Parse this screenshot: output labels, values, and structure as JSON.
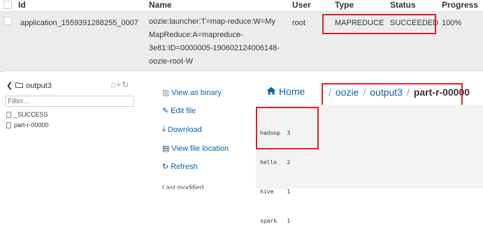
{
  "jobs_table": {
    "headers": [
      "Id",
      "Name",
      "User",
      "Type",
      "Status",
      "Progress"
    ],
    "row": {
      "id": "application_1559391288255_0007",
      "name_lines": [
        "oozie:launcher:T=map-reduce:W=My",
        "MapReduce:A=mapreduce-",
        "3e81:ID=0000005-190602124006148-",
        "oozie-root-W"
      ],
      "user": "root",
      "type": "MAPREDUCE",
      "status": "SUCCEEDED",
      "progress": "100%"
    }
  },
  "file_browser": {
    "folder_name": "output3",
    "back_icon": "chevron-left-icon",
    "folder_icon": "folder-icon",
    "actions_icons": [
      "home-icon",
      "plus-icon",
      "refresh-icon"
    ],
    "actions_glyphs": "⌂+↻",
    "filter_placeholder": "Filter...",
    "files": [
      "_SUCCESS",
      "part-r-00000"
    ]
  },
  "file_actions": {
    "view_as_binary": "View as binary",
    "edit_file": "Edit file",
    "download": "Download",
    "view_file_location": "View file location",
    "refresh": "Refresh",
    "last_modified_label": "Last modified"
  },
  "breadcrumb": {
    "home": "Home",
    "separator": "/",
    "parts": [
      "oozie",
      "output3",
      "part-r-00000"
    ]
  },
  "file_content": {
    "lines": [
      "hadoop  3",
      "hello   2",
      "hive    1",
      "spark   1"
    ]
  },
  "colors": {
    "highlight": "#e41f2d",
    "link": "#0b63ab",
    "row_bg": "#ececec",
    "content_bg": "#f3f3f3"
  }
}
